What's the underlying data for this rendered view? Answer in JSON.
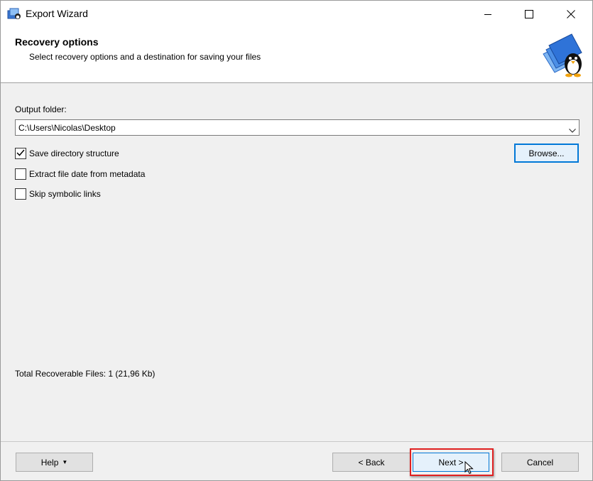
{
  "window": {
    "title": "Export Wizard"
  },
  "header": {
    "title": "Recovery options",
    "subtitle": "Select recovery options and a destination for saving your files"
  },
  "output": {
    "label": "Output folder:",
    "path": "C:\\Users\\Nicolas\\Desktop",
    "browse_label": "Browse..."
  },
  "options": [
    {
      "label": "Save directory structure",
      "checked": true
    },
    {
      "label": "Extract file date from metadata",
      "checked": false
    },
    {
      "label": "Skip symbolic links",
      "checked": false
    }
  ],
  "status": {
    "text": "Total Recoverable Files: 1 (21,96 Kb)"
  },
  "footer": {
    "help_label": "Help",
    "back_label": "< Back",
    "next_label": "Next >",
    "cancel_label": "Cancel"
  },
  "icons": {
    "app": "export-wizard-icon",
    "logo": "penguin-folders-logo",
    "minimize": "minimize-icon",
    "maximize": "maximize-icon",
    "close": "close-icon",
    "dropdown": "chevron-down-icon",
    "check": "checkmark-icon",
    "cursor": "mouse-pointer-icon"
  },
  "colors": {
    "accent": "#0078d7",
    "highlight": "#e02020",
    "background": "#f0f0f0"
  }
}
